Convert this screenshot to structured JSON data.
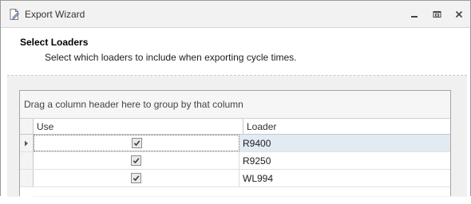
{
  "window": {
    "title": "Export Wizard",
    "icon": "document-pencil-icon"
  },
  "header": {
    "title": "Select Loaders",
    "subtitle": "Select which loaders to include when exporting cycle times."
  },
  "grid": {
    "group_panel_text": "Drag a column header here to group by that column",
    "columns": [
      "Use",
      "Loader"
    ],
    "rows": [
      {
        "use": true,
        "loader": "R9400",
        "selected": true
      },
      {
        "use": true,
        "loader": "R9250",
        "selected": false
      },
      {
        "use": true,
        "loader": "WL994",
        "selected": false
      }
    ]
  },
  "colors": {
    "selected_row": "#e2eaf3",
    "body_background": "#f0f0f0"
  }
}
